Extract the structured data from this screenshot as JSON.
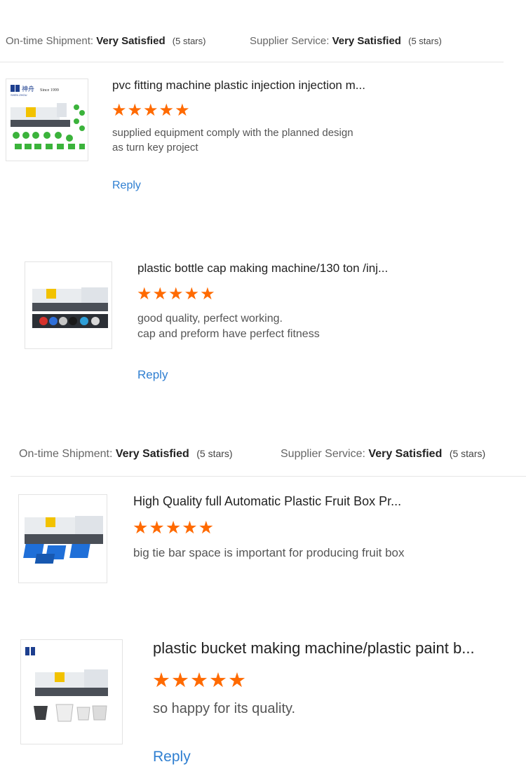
{
  "groups": [
    {
      "shipment_label": "On-time Shipment:",
      "shipment_value": "Very Satisfied",
      "shipment_count": "(5 stars)",
      "service_label": "Supplier Service:",
      "service_value": "Very Satisfied",
      "service_count": "(5 stars)"
    },
    {
      "shipment_label": "On-time Shipment:",
      "shipment_value": "Very Satisfied",
      "shipment_count": "(5 stars)",
      "service_label": "Supplier Service:",
      "service_value": "Very Satisfied",
      "service_count": "(5 stars)"
    }
  ],
  "reviews": [
    {
      "title": "pvc fitting machine plastic injection injection m...",
      "rating": 5,
      "stars_text": "★★★★★",
      "comment": "supplied equipment comply with the planned design\nas turn key project",
      "reply_label": "Reply",
      "logo_text": "SHEN ZHOU",
      "logo_cn": "神舟",
      "since_text": "Since 1999"
    },
    {
      "title": "plastic bottle cap making machine/130 ton /inj...",
      "rating": 5,
      "stars_text": "★★★★★",
      "comment": "good quality, perfect working.\ncap and preform have perfect fitness",
      "reply_label": "Reply"
    },
    {
      "title": "High Quality full Automatic Plastic Fruit Box Pr...",
      "rating": 5,
      "stars_text": "★★★★★",
      "comment": "big tie bar space is important for producing fruit box"
    },
    {
      "title": "plastic bucket making machine/plastic paint b...",
      "rating": 5,
      "stars_text": "★★★★★",
      "comment": "so happy for its quality.",
      "reply_label": "Reply"
    }
  ],
  "colors": {
    "star": "#ff6a00",
    "link": "#2f7fd1",
    "machine_yellow": "#f2c200",
    "machine_body": "#e9ecef",
    "pipe_green": "#3bb33b",
    "crate_blue": "#1f6fd8"
  }
}
